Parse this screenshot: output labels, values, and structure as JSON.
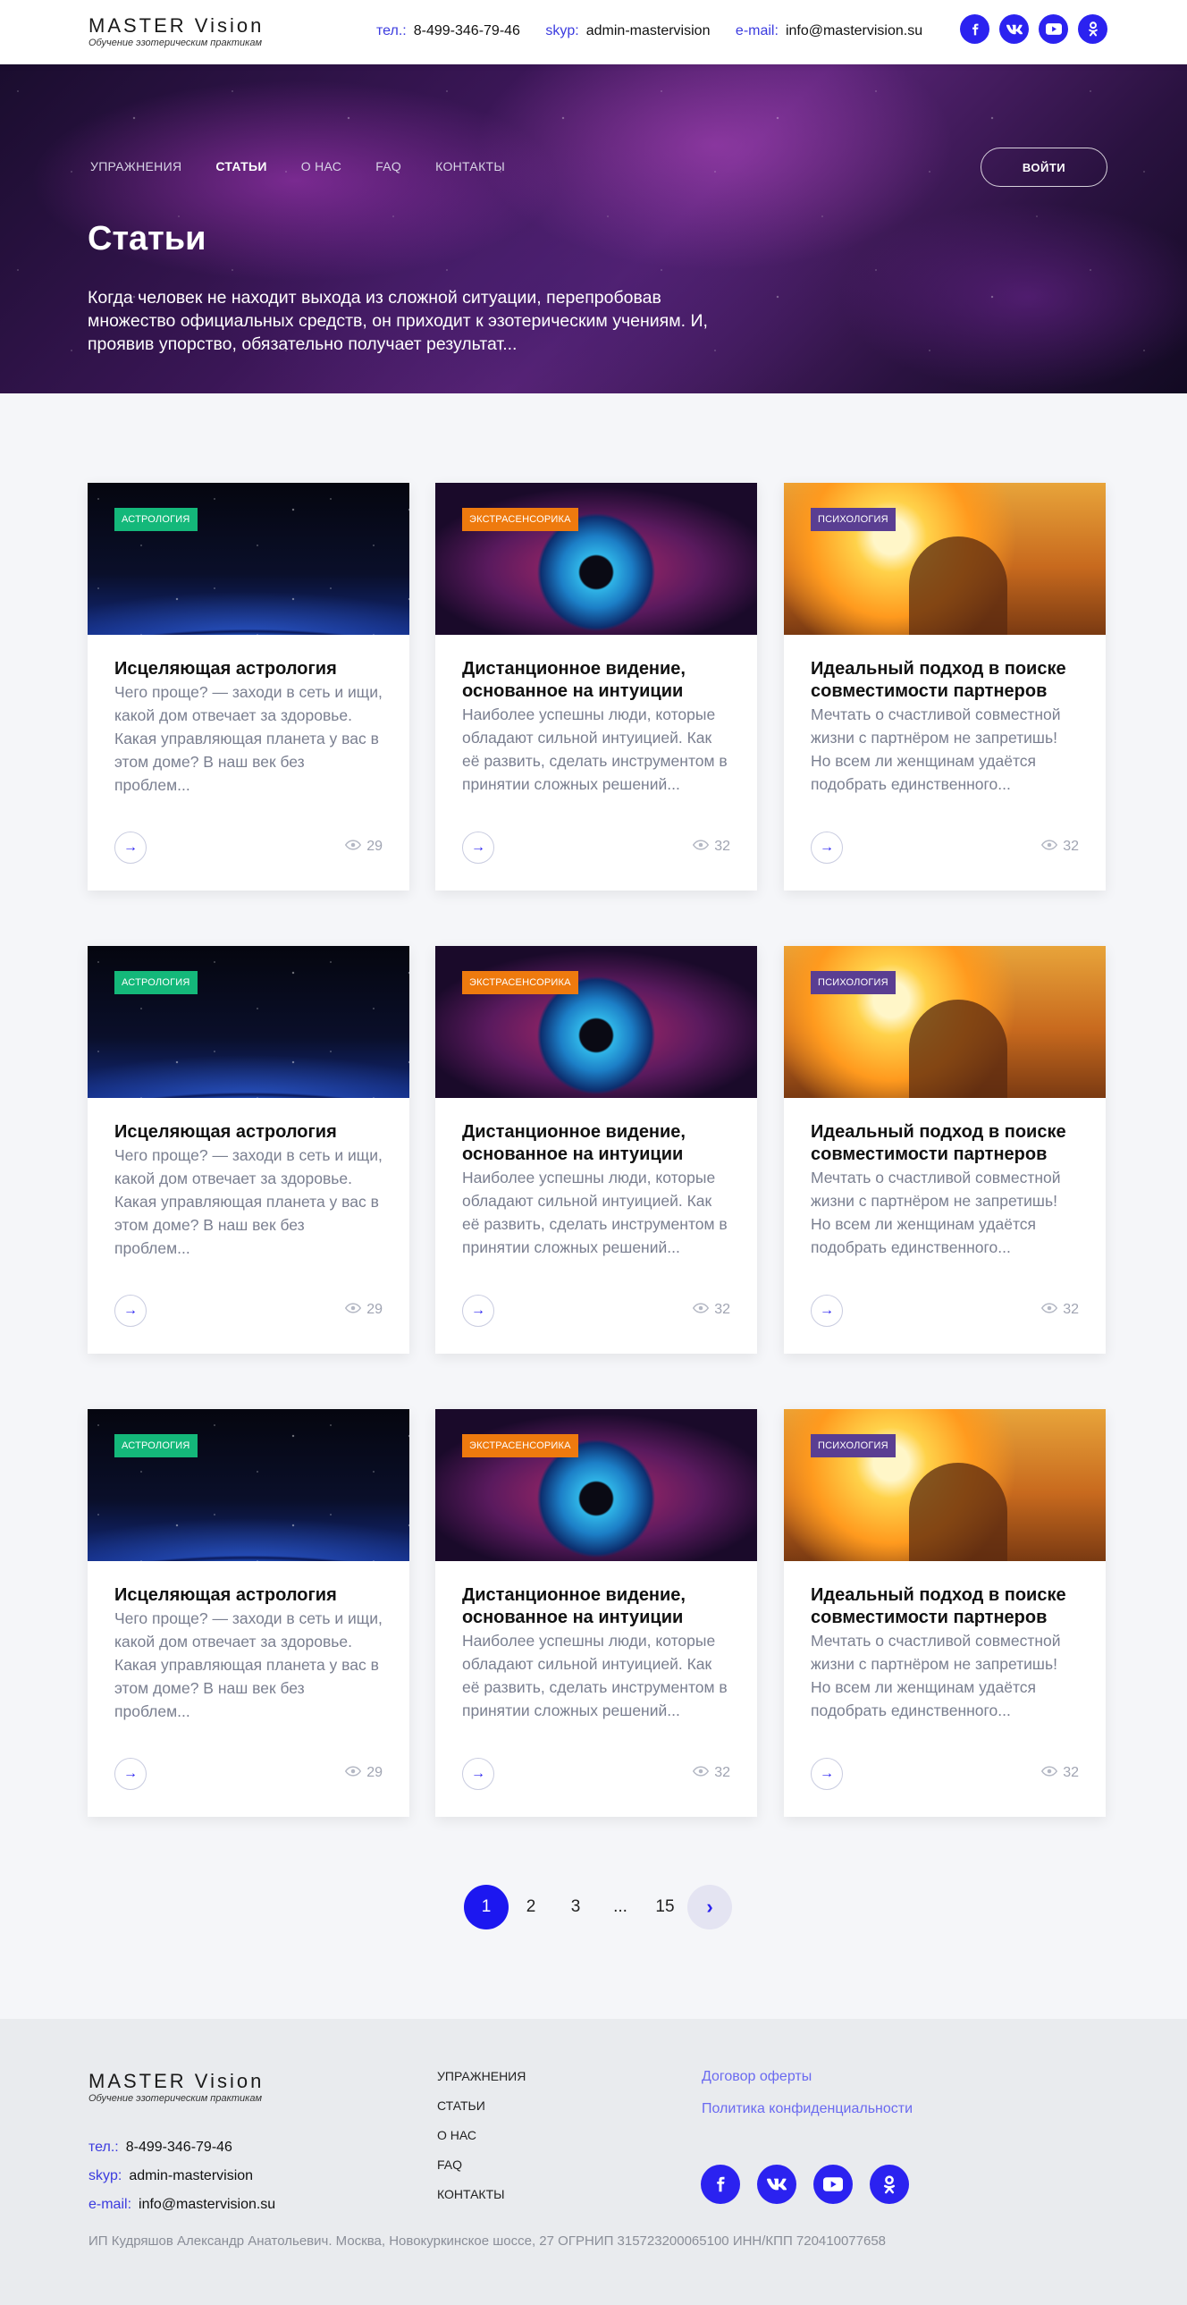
{
  "header": {
    "logo_brand": "MASTER Vision",
    "logo_tagline": "Обучение эзотерическим практикам",
    "contacts": [
      {
        "key": "тел.:",
        "value": "8-499-346-79-46"
      },
      {
        "key": "skyp:",
        "value": "admin-mastervision"
      },
      {
        "key": "e-mail:",
        "value": "info@mastervision.su"
      }
    ],
    "socials": [
      "facebook-icon",
      "vk-icon",
      "youtube-icon",
      "odnoklassniki-icon"
    ]
  },
  "nav": {
    "items": [
      "УПРАЖНЕНИЯ",
      "СТАТЬИ",
      "О НАС",
      "FAQ",
      "КОНТАКТЫ"
    ],
    "active": "СТАТЬИ",
    "login_label": "ВОЙТИ"
  },
  "hero": {
    "title": "Статьи",
    "text": "Когда человек не находит выхода из сложной ситуации, перепробовав множество официальных средств, он приходит к эзотерическим учениям. И, проявив упорство, обязательно получает результат..."
  },
  "cards": [
    {
      "category": "АСТРОЛОГИЯ",
      "category_color": "#14b87a",
      "title": "Исцеляющая астрология",
      "excerpt": "Чего проще? — заходи в сеть и ищи, какой дом отвечает за здоровье. Какая управляющая планета у вас в этом доме? В наш век без проблем...",
      "views": "29"
    },
    {
      "category": "ЭКСТРАСЕНСОРИКА",
      "category_color": "#ee7a0e",
      "title": "Дистанционное видение, основанное на интуиции",
      "excerpt": "Наиболее успешны люди, которые обладают сильной интуицией. Как её развить, сделать инструментом в принятии сложных решений...",
      "views": "32"
    },
    {
      "category": "ПСИХОЛОГИЯ",
      "category_color": "#5a3e92",
      "title": "Идеальный подход в поиске совместимости партнеров",
      "excerpt": "Мечтать о счастливой совместной жизни с партнёром не запретишь! Но всем ли женщинам удаётся подобрать единственного...",
      "views": "32"
    },
    {
      "category": "АСТРОЛОГИЯ",
      "category_color": "#14b87a",
      "title": "Исцеляющая астрология",
      "excerpt": "Чего проще? — заходи в сеть и ищи, какой дом отвечает за здоровье. Какая управляющая планета у вас в этом доме? В наш век без проблем...",
      "views": "29"
    },
    {
      "category": "ЭКСТРАСЕНСОРИКА",
      "category_color": "#ee7a0e",
      "title": "Дистанционное видение, основанное на интуиции",
      "excerpt": "Наиболее успешны люди, которые обладают сильной интуицией. Как её развить, сделать инструментом в принятии сложных решений...",
      "views": "32"
    },
    {
      "category": "ПСИХОЛОГИЯ",
      "category_color": "#5a3e92",
      "title": "Идеальный подход в поиске совместимости партнеров",
      "excerpt": "Мечтать о счастливой совместной жизни с партнёром не запретишь! Но всем ли женщинам удаётся подобрать единственного...",
      "views": "32"
    },
    {
      "category": "АСТРОЛОГИЯ",
      "category_color": "#14b87a",
      "title": "Исцеляющая астрология",
      "excerpt": "Чего проще? — заходи в сеть и ищи, какой дом отвечает за здоровье. Какая управляющая планета у вас в этом доме? В наш век без проблем...",
      "views": "29"
    },
    {
      "category": "ЭКСТРАСЕНСОРИКА",
      "category_color": "#ee7a0e",
      "title": "Дистанционное видение, основанное на интуиции",
      "excerpt": "Наиболее успешны люди, которые обладают сильной интуицией. Как её развить, сделать инструментом в принятии сложных решений...",
      "views": "32"
    },
    {
      "category": "ПСИХОЛОГИЯ",
      "category_color": "#5a3e92",
      "title": "Идеальный подход в поиске совместимости партнеров",
      "excerpt": "Мечтать о счастливой совместной жизни с партнёром не запретишь! Но всем ли женщинам удаётся подобрать единственного...",
      "views": "32"
    }
  ],
  "pagination": {
    "pages": [
      "1",
      "2",
      "3",
      "...",
      "15"
    ],
    "current": "1",
    "next_icon": "chevron-right-icon"
  },
  "footer": {
    "logo_brand": "MASTER Vision",
    "logo_tagline": "Обучение эзотерическим практикам",
    "contacts": [
      {
        "key": "тел.:",
        "value": "8-499-346-79-46"
      },
      {
        "key": "skyp:",
        "value": "admin-mastervision"
      },
      {
        "key": "e-mail:",
        "value": "info@mastervision.su"
      }
    ],
    "nav": [
      "УПРАЖНЕНИЯ",
      "СТАТЬИ",
      "О НАС",
      "FAQ",
      "КОНТАКТЫ"
    ],
    "links": [
      "Договор оферты",
      "Политика конфиденциальности"
    ],
    "copyright": "ИП Кудряшов Александр Анатольевич. Москва, Новокуркинское шоссе, 27 ОГРНИП 315723200065100 ИНН/КПП 720410077658"
  },
  "colors": {
    "accent": "#2b22f0",
    "page_bg": "#f5f6f9",
    "footer_bg": "#e9ebee"
  }
}
